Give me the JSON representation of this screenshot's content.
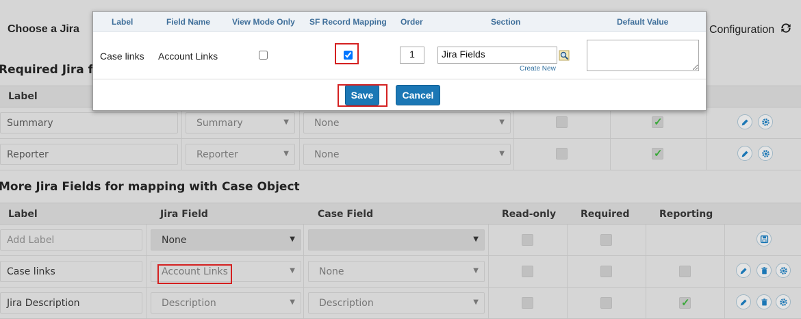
{
  "background": {
    "page_title": "Choose a Jira",
    "configuration_label": "Configuration",
    "required_section_title": "Required Jira f",
    "required_header": {
      "label": "Label"
    },
    "required_rows": [
      {
        "label": "Summary",
        "jira_field": "Summary",
        "case_field": "None",
        "checked_reporting": true
      },
      {
        "label": "Reporter",
        "jira_field": "Reporter",
        "case_field": "None",
        "checked_reporting": true
      }
    ],
    "more_section_title": "More Jira Fields for mapping with Case Object",
    "more_header": {
      "label": "Label",
      "jira_field": "Jira Field",
      "case_field": "Case Field",
      "read_only": "Read-only",
      "required": "Required",
      "reporting": "Reporting"
    },
    "more_rows": [
      {
        "label": "",
        "label_placeholder": "Add Label",
        "jira_field": "None",
        "case_field": ""
      },
      {
        "label": "Case links",
        "jira_field": "Account Links",
        "case_field": "None"
      },
      {
        "label": "Jira Description",
        "jira_field": "Description",
        "case_field": "Description",
        "checked_reporting": true
      }
    ]
  },
  "modal": {
    "headers": {
      "label": "Label",
      "field_name": "Field Name",
      "view_mode_only": "View Mode Only",
      "sf_record_mapping": "SF Record Mapping",
      "order": "Order",
      "section": "Section",
      "default_value": "Default Value"
    },
    "row": {
      "label": "Case links",
      "field_name": "Account Links",
      "view_mode_only": false,
      "sf_record_mapping": true,
      "order": "1",
      "section": "Jira Fields",
      "create_new": "Create New",
      "default_value": ""
    },
    "save_label": "Save",
    "cancel_label": "Cancel"
  },
  "colors": {
    "accent": "#1b77b5",
    "highlight": "#d42020",
    "check": "#3aa83a"
  }
}
